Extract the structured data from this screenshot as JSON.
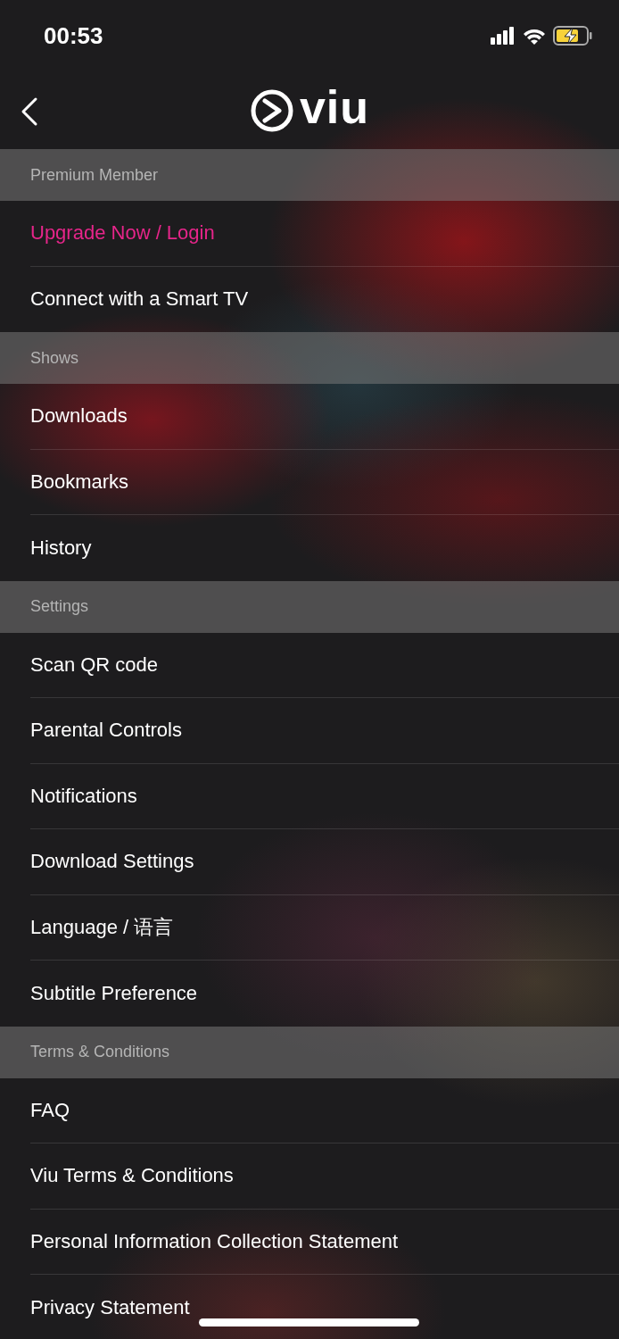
{
  "status_bar": {
    "time": "00:53",
    "charging": true
  },
  "header": {
    "logo_text": "viu"
  },
  "sections": [
    {
      "title": "Premium Member",
      "items": [
        {
          "label": "Upgrade Now / Login",
          "kind": "accent"
        },
        {
          "label": "Connect with a Smart TV",
          "kind": "plain"
        }
      ]
    },
    {
      "title": "Shows",
      "items": [
        {
          "label": "Downloads",
          "kind": "plain"
        },
        {
          "label": "Bookmarks",
          "kind": "plain"
        },
        {
          "label": "History",
          "kind": "plain"
        }
      ]
    },
    {
      "title": "Settings",
      "items": [
        {
          "label": "Scan QR code",
          "kind": "plain"
        },
        {
          "label": "Parental Controls",
          "kind": "plain"
        },
        {
          "label": "Notifications",
          "kind": "plain"
        },
        {
          "label": "Download Settings",
          "kind": "plain"
        },
        {
          "label": "Language / 语言",
          "kind": "plain"
        },
        {
          "label": "Subtitle Preference",
          "kind": "plain"
        }
      ]
    },
    {
      "title": "Terms & Conditions",
      "items": [
        {
          "label": "FAQ",
          "kind": "plain"
        },
        {
          "label": "Viu Terms & Conditions",
          "kind": "plain"
        },
        {
          "label": "Personal Information Collection Statement",
          "kind": "plain"
        },
        {
          "label": "Privacy Statement",
          "kind": "plain"
        }
      ]
    }
  ]
}
